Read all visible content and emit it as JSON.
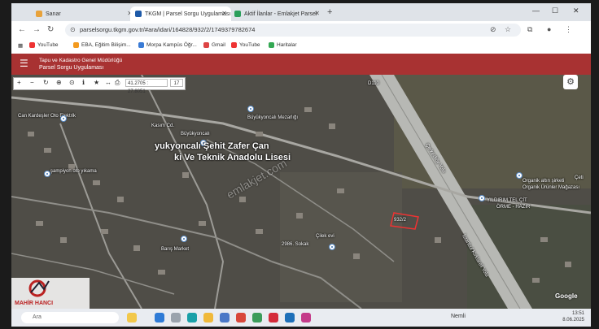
{
  "tabs": [
    {
      "label": "Sanar",
      "active": false,
      "color": "#e8a23a"
    },
    {
      "label": "TKGM | Parsel Sorgu Uygulaması",
      "active": true,
      "color": "#1e5aa8"
    },
    {
      "label": "Aktif İlanlar - Emlakjet Parsel",
      "active": false,
      "color": "#2b9f5b"
    }
  ],
  "address": {
    "url": "parselsorgu.tkgm.gov.tr/#ara/idari/164828/932/2/1749379782674"
  },
  "bookmarks": [
    {
      "label": "YouTube",
      "color": "#e33"
    },
    {
      "label": "EBA, Eğitim Bilişim...",
      "color": "#f39a1f"
    },
    {
      "label": "Morpa Kampüs Öğr...",
      "color": "#3a7bd5"
    },
    {
      "label": "Gmail",
      "color": "#d44"
    },
    {
      "label": "YouTube",
      "color": "#e33"
    },
    {
      "label": "Haritalar",
      "color": "#34a853"
    }
  ],
  "header": {
    "line1": "Tapu ve Kadastro Genel Müdürlüğü",
    "line2": "Parsel Sorgu Uygulaması",
    "color": "#a83232"
  },
  "map_toolbar": {
    "coord": "41.2705 : 27.8051",
    "zoom": "17"
  },
  "map_labels": {
    "mezarligi": "Büyükyoncalı Mezarlığı",
    "kasim": "Kasım Cd.",
    "buyukyoncali": "Büyükyoncalı",
    "school1": "yukyoncalı Şehit Zafer Çan",
    "school2": "ki Ve Teknik Anadolu Lisesi",
    "can": "Can Kardeşler Oto Elektrik",
    "sampiyon": "şampiyon oto yıkama",
    "baris": "Barış Market",
    "sokak": "2986. Sokak",
    "cilek": "Çilek evi",
    "organik1": "Organik altın şirketi",
    "organik2": "Organik Ürünler Mağazası",
    "yildirim1": "YILDIRIM TEL ÇİT",
    "yildirim2": "ÖRME - HAZIR",
    "parcel": "932/2",
    "cerkezkoy": "Çerkezköy Yolu",
    "istanbul": "İstanbul Kırklareli Yolu",
    "road": "D110",
    "ceti": "Çeti",
    "watermark": "emlakjet.com"
  },
  "google": "Google",
  "logo": {
    "name": "MAHİR HANCI"
  },
  "taskbar": {
    "search": "Ara",
    "weather": "Nemli",
    "time": "13:51",
    "date": "8.06.2025"
  }
}
